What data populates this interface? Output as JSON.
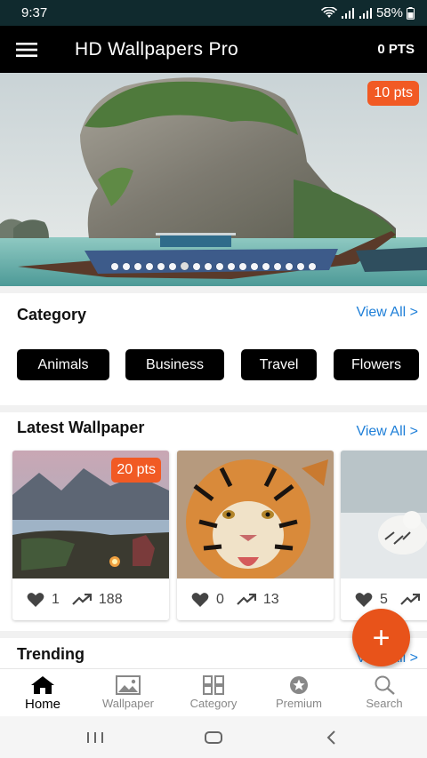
{
  "status_bar": {
    "time": "9:37",
    "battery": "58%"
  },
  "app_bar": {
    "title": "HD Wallpapers Pro",
    "points": "0 PTS"
  },
  "banner": {
    "badge": "10 pts",
    "slide_count": 18,
    "active_slide": 6
  },
  "category_section": {
    "title": "Category",
    "view_all": "View All >",
    "chips": [
      "Animals",
      "Business",
      "Travel",
      "Flowers"
    ]
  },
  "latest_section": {
    "title": "Latest Wallpaper",
    "view_all": "View All >",
    "cards": [
      {
        "badge": "20 pts",
        "likes": "1",
        "views": "188"
      },
      {
        "badge": "",
        "likes": "0",
        "views": "13"
      },
      {
        "badge": "",
        "likes": "5",
        "views": ""
      }
    ]
  },
  "trending_section": {
    "title": "Trending",
    "view_all": "View All >"
  },
  "fab": {
    "label": "+"
  },
  "bottom_nav": {
    "items": [
      {
        "label": "Home",
        "icon": "home-icon"
      },
      {
        "label": "Wallpaper",
        "icon": "image-icon"
      },
      {
        "label": "Category",
        "icon": "grid-icon"
      },
      {
        "label": "Premium",
        "icon": "star-badge-icon"
      },
      {
        "label": "Search",
        "icon": "search-icon"
      }
    ],
    "active": 0
  },
  "colors": {
    "accent": "#f15a24",
    "link": "#1e7fd8",
    "app_bar": "#000000",
    "status_bar": "#102a2e"
  }
}
